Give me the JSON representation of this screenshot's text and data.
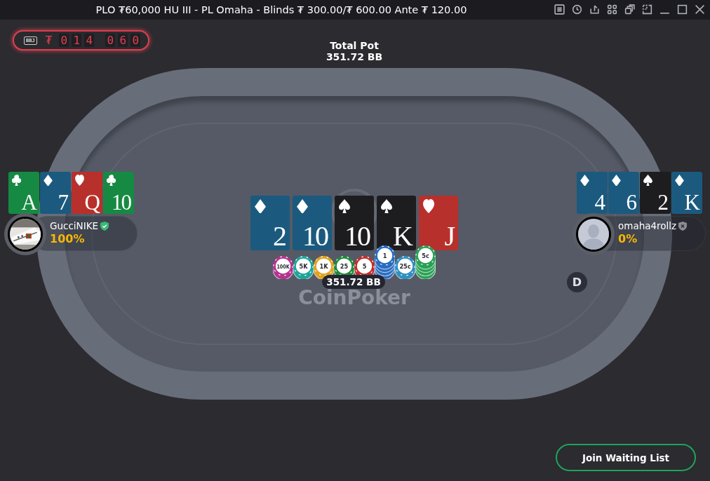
{
  "window": {
    "title": "PLO ₮60,000 HU III - PL Omaha - Blinds ₮ 300.00/₮ 600.00 Ante ₮ 120.00"
  },
  "counter": {
    "badge": "BBJ",
    "currency": "₮",
    "digits": [
      "0",
      "1",
      "4",
      "0",
      "6",
      "0"
    ]
  },
  "total_pot": {
    "label": "Total Pot",
    "amount": "351.72 BB"
  },
  "table": {
    "logo": "CoinPoker"
  },
  "board": [
    {
      "rank": "2",
      "kind": "diamonds"
    },
    {
      "rank": "10",
      "kind": "diamonds"
    },
    {
      "rank": "10",
      "kind": "spades"
    },
    {
      "rank": "K",
      "kind": "spades"
    },
    {
      "rank": "J",
      "kind": "hearts"
    }
  ],
  "chips": [
    {
      "label": "100K",
      "color": "#b5338f",
      "stacked": false
    },
    {
      "label": "5K",
      "color": "#1fa59a",
      "stacked": false
    },
    {
      "label": "1K",
      "color": "#e0a21c",
      "stacked": false
    },
    {
      "label": "25",
      "color": "#1e8a3c",
      "stacked": false
    },
    {
      "label": "5",
      "color": "#c0302e",
      "stacked": false
    },
    {
      "label": "1",
      "color": "#2a6cc0",
      "stacked": true
    },
    {
      "label": "25c",
      "color": "#2f8fc0",
      "stacked": false
    },
    {
      "label": "5c",
      "color": "#2aa055",
      "stacked": true
    }
  ],
  "pot": {
    "amount": "351.72 BB"
  },
  "seats": [
    {
      "name": "GucciNIKE",
      "equity": "100%",
      "verified": true,
      "avatar": {
        "kind": "picture"
      },
      "dealer": false,
      "cards": [
        {
          "rank": "A",
          "kind": "clubs"
        },
        {
          "rank": "7",
          "kind": "diamonds"
        },
        {
          "rank": "Q",
          "kind": "hearts"
        },
        {
          "rank": "10",
          "kind": "clubs"
        }
      ]
    },
    {
      "name": "omaha4rollz",
      "equity": "0%",
      "verified": false,
      "avatar": {
        "kind": "silhouette"
      },
      "dealer": true,
      "dealer_label": "D",
      "cards": [
        {
          "rank": "4",
          "kind": "diamonds"
        },
        {
          "rank": "6",
          "kind": "diamonds"
        },
        {
          "rank": "2",
          "kind": "spades"
        },
        {
          "rank": "K",
          "kind": "diamonds"
        }
      ]
    }
  ],
  "buttons": [
    {
      "label": "Join Waiting List"
    }
  ]
}
